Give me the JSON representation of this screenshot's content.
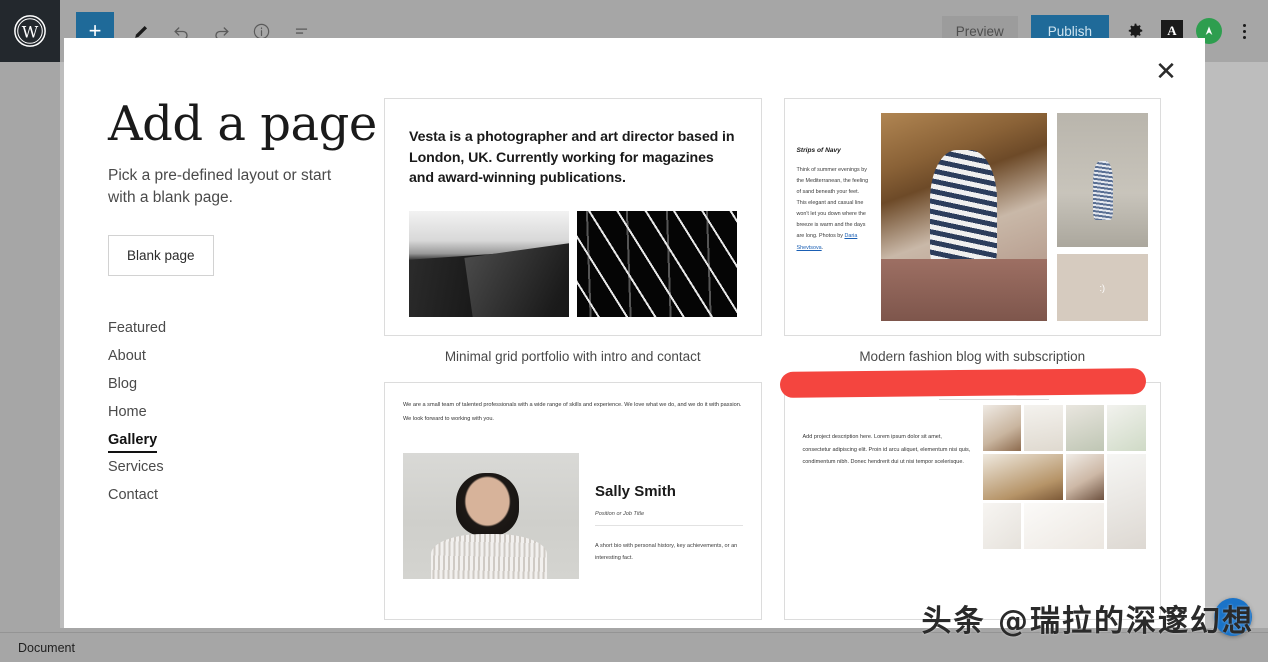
{
  "editor": {
    "logo_icon": "wordpress-logo-icon",
    "toolbar": {
      "add_block_label": "+",
      "icons": [
        "add-block-icon",
        "pencil-edit-icon",
        "undo-icon",
        "redo-icon",
        "info-icon",
        "list-view-icon"
      ],
      "preview_label": "Preview",
      "publish_label": "Publish",
      "settings_icon": "gear-icon",
      "typography_icon": "letter-a-icon",
      "avatar_icon": "user-avatar-icon",
      "more_menu_icon": "kebab-menu-icon"
    },
    "status_bar": {
      "label": "Document"
    }
  },
  "modal": {
    "close_icon": "close-x-icon",
    "title": "Add a page",
    "subtitle": "Pick a pre-defined layout or start with a blank page.",
    "blank_page_label": "Blank page",
    "categories": [
      {
        "label": "Featured",
        "active": false
      },
      {
        "label": "About",
        "active": false
      },
      {
        "label": "Blog",
        "active": false
      },
      {
        "label": "Home",
        "active": false
      },
      {
        "label": "Gallery",
        "active": true
      },
      {
        "label": "Services",
        "active": false
      },
      {
        "label": "Contact",
        "active": false
      }
    ],
    "templates": [
      {
        "caption": "Minimal grid portfolio with intro and contact",
        "headline": "Vesta is a photographer and art director based in London, UK. Currently working for magazines and award-winning publications."
      },
      {
        "caption": "Modern fashion blog with subscription",
        "headline": "Strips of Navy",
        "body": "Think of summer evenings by the Mediterranean, the feeling of sand beneath your feet. This elegant and casual line won't let you down where the breeze is warm and the days are long. Photos by ",
        "link_text": "Daria Shevtsova",
        "body_end": ".",
        "emoji": ":)"
      },
      {
        "caption": "",
        "intro": "We are a small team of talented professionals with a wide range of skills and experience. We love what we do, and we do it with passion. We look forward to working with you.",
        "name": "Sally Smith",
        "position": "Position or Job Title",
        "bio": "A short bio with personal history, key achievements, or an interesting fact."
      },
      {
        "caption": "",
        "body": "Add project description here. Lorem ipsum dolor sit amet, consectetur adipiscing elit. Proin id arcu aliquet, elementum nisi quis, condimentum nibh. Donec hendrerit dui ut nisi tempor scelerisque.",
        "annotation_color": "#f4453f"
      }
    ]
  },
  "overlay": {
    "watermark": "头条 @瑞拉的深邃幻想",
    "help_button_icon": "help-bubble-icon"
  },
  "colors": {
    "accent_blue": "#1f6a99",
    "annotation_red": "#f4453f",
    "avatar_green": "#2e9e4f",
    "chrome_gray": "#a6a6a6"
  }
}
